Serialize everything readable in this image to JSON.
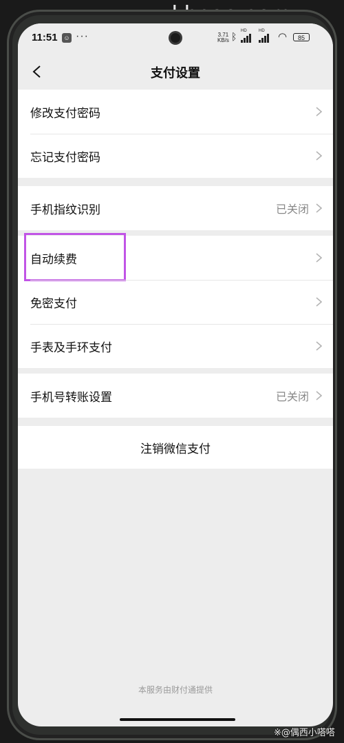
{
  "watermark_top": "khcoo.com",
  "watermark_bottom": "※@偶西小嗒嗒",
  "status_bar": {
    "time": "11:51",
    "more": "···",
    "net_speed_value": "3.71",
    "net_speed_unit": "KB/s",
    "signal_1_label": "HD",
    "signal_2_label": "HD",
    "battery": "85"
  },
  "nav": {
    "title": "支付设置",
    "back_icon": "chevron-left-icon"
  },
  "groups": [
    {
      "items": [
        {
          "label": "修改支付密码",
          "value": ""
        },
        {
          "label": "忘记支付密码",
          "value": ""
        }
      ]
    },
    {
      "items": [
        {
          "label": "手机指纹识别",
          "value": "已关闭"
        }
      ]
    },
    {
      "items": [
        {
          "label": "自动续费",
          "value": "",
          "highlighted": true
        },
        {
          "label": "免密支付",
          "value": ""
        },
        {
          "label": "手表及手环支付",
          "value": ""
        }
      ]
    },
    {
      "items": [
        {
          "label": "手机号转账设置",
          "value": "已关闭"
        }
      ]
    }
  ],
  "cancel_button": "注销微信支付",
  "footer_note": "本服务由财付通提供",
  "colors": {
    "background": "#ededed",
    "card": "#ffffff",
    "highlight": "#c154e6",
    "secondary_text": "#888888"
  }
}
